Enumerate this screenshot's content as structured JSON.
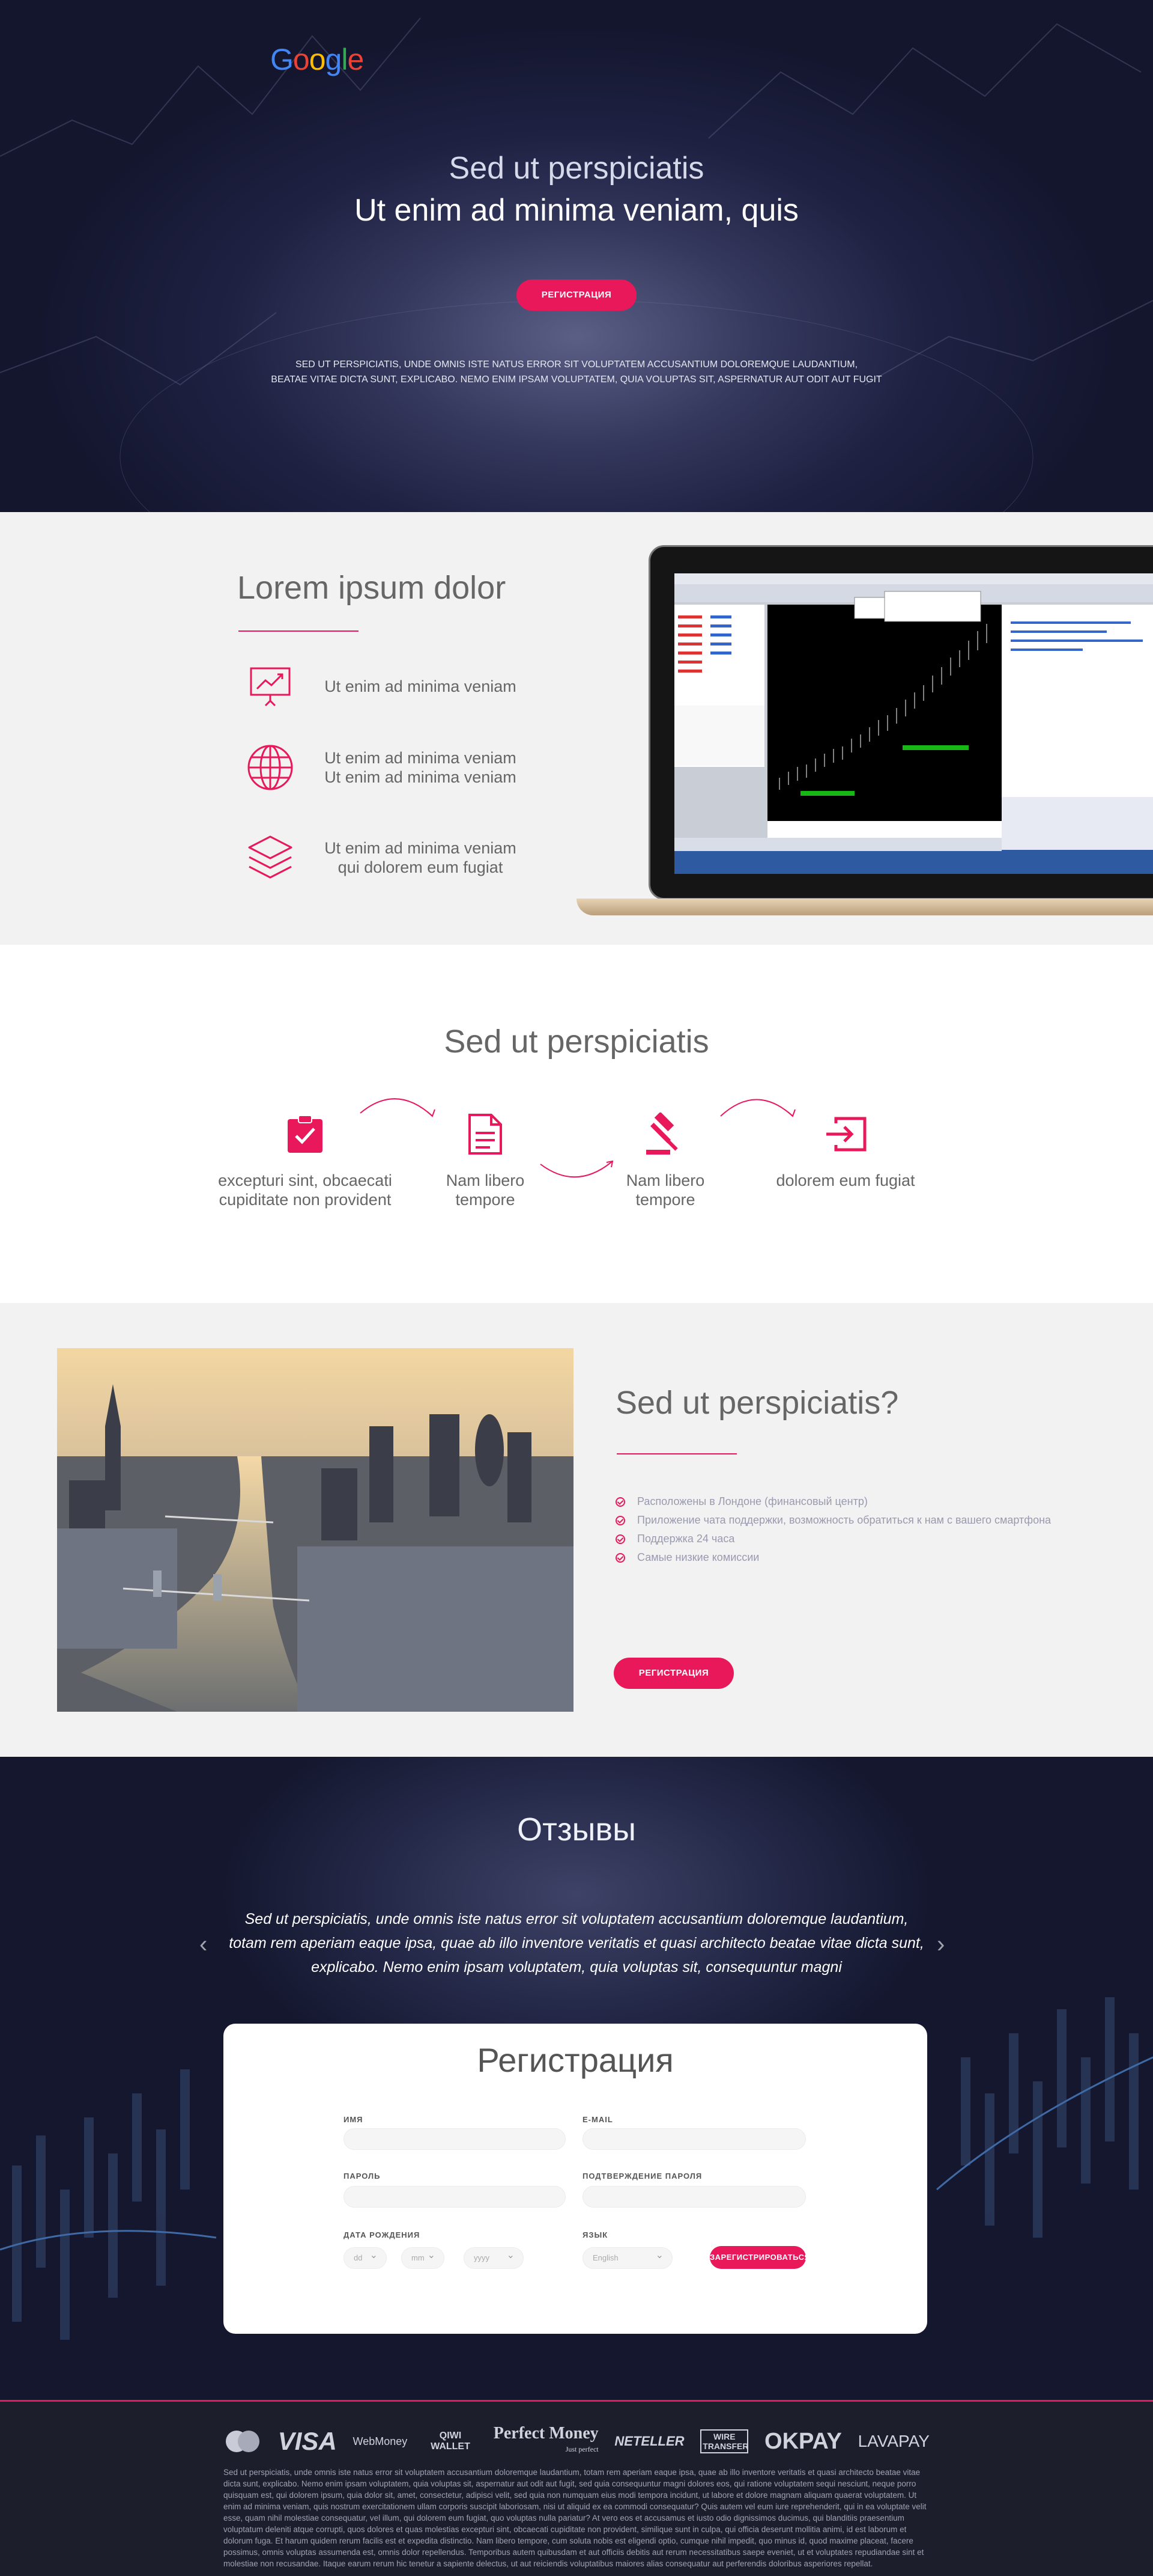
{
  "hero": {
    "logo": "Google",
    "subtitle": "Sed ut perspiciatis",
    "title": "Ut enim ad minima veniam, quis",
    "button": "РЕГИСТРАЦИЯ",
    "description_1": "SED UT PERSPICIATIS, UNDE OMNIS ISTE NATUS ERROR SIT VOLUPTATEM ACCUSANTIUM DOLOREMQUE LAUDANTIUM,",
    "description_2": "BEATAE VITAE DICTA SUNT, EXPLICABO. NEMO ENIM IPSAM VOLUPTATEM, QUIA VOLUPTAS SIT, ASPERNATUR AUT ODIT AUT FUGIT"
  },
  "features": {
    "title": "Lorem ipsum dolor",
    "items": [
      {
        "icon": "presentation-chart-icon",
        "line1": "Ut enim ad minima veniam",
        "line2": ""
      },
      {
        "icon": "globe-icon",
        "line1": "Ut enim ad minima veniam",
        "line2": "Ut enim ad minima veniam"
      },
      {
        "icon": "layers-icon",
        "line1": "Ut enim ad minima veniam",
        "line2": "qui dolorem eum fugiat"
      }
    ]
  },
  "steps": {
    "title": "Sed ut perspiciatis",
    "items": [
      {
        "icon": "clipboard-check-icon",
        "line1": "excepturi sint, obcaecati",
        "line2": "cupiditate non provident"
      },
      {
        "icon": "document-icon",
        "line1": "Nam libero",
        "line2": "tempore"
      },
      {
        "icon": "gavel-icon",
        "line1": "Nam libero",
        "line2": "tempore"
      },
      {
        "icon": "login-icon",
        "line1": "dolorem eum fugiat",
        "line2": ""
      }
    ]
  },
  "about": {
    "title": "Sed ut perspiciatis?",
    "list": [
      "Расположены в Лондоне (финансовый центр)",
      "Приложение чата поддержки, возможность обратиться к нам с вашего смартфона",
      "Поддержка 24 часа",
      "Самые низкие комиссии"
    ],
    "button": "РЕГИСТРАЦИЯ"
  },
  "reviews": {
    "title": "Отзывы",
    "text_1": "Sed ut perspiciatis, unde omnis iste natus error sit voluptatem accusantium doloremque laudantium,",
    "text_2": "totam rem aperiam eaque ipsa, quae ab illo inventore veritatis et quasi architecto beatae vitae dicta sunt,",
    "text_3": "explicabo. Nemo enim ipsam voluptatem, quia voluptas sit, consequuntur magni"
  },
  "registration": {
    "title": "Регистрация",
    "name_label": "ИМЯ",
    "email_label": "E-MAIL",
    "password_label": "ПАРОЛЬ",
    "confirm_label": "ПОДТВЕРЖДЕНИЕ ПАРОЛЯ",
    "dob_label": "ДАТА РОЖДЕНИЯ",
    "lang_label": "ЯЗЫК",
    "dd": "dd",
    "mm": "mm",
    "yyyy": "yyyy",
    "lang_value": "English",
    "submit": "ЗАРЕГИСТРИРОВАТЬСЯ"
  },
  "footer": {
    "payments": [
      "MasterCard",
      "VISA",
      "WebMoney",
      "QIWI WALLET",
      "Perfect Money",
      "NETELLER",
      "WIRE TRANSFER",
      "OKPAY",
      "LAVAPAY"
    ],
    "perfect_money_sub": "Just perfect",
    "text": "Sed ut perspiciatis, unde omnis iste natus error sit voluptatem accusantium doloremque laudantium, totam rem aperiam eaque ipsa, quae ab illo inventore veritatis et quasi architecto beatae vitae dicta sunt, explicabo. Nemo enim ipsam voluptatem, quia voluptas sit, aspernatur aut odit aut fugit, sed quia consequuntur magni dolores eos, qui ratione voluptatem sequi nesciunt, neque porro quisquam est, qui dolorem ipsum, quia dolor sit, amet, consectetur, adipisci velit, sed quia non numquam eius modi tempora incidunt, ut labore et dolore magnam aliquam quaerat voluptatem. Ut enim ad minima veniam, quis nostrum exercitationem ullam corporis suscipit laboriosam, nisi ut aliquid ex ea commodi consequatur? Quis autem vel eum iure reprehenderit, qui in ea voluptate velit esse, quam nihil molestiae consequatur, vel illum, qui dolorem eum fugiat, quo voluptas nulla pariatur? At vero eos et accusamus et iusto odio dignissimos ducimus, qui blanditiis praesentium voluptatum deleniti atque corrupti, quos dolores et quas molestias excepturi sint, obcaecati cupiditate non provident, similique sunt in culpa, qui officia deserunt mollitia animi, id est laborum et dolorum fuga. Et harum quidem rerum facilis est et expedita distinctio. Nam libero tempore, cum soluta nobis est eligendi optio, cumque nihil impedit, quo minus id, quod maxime placeat, facere possimus, omnis voluptas assumenda est, omnis dolor repellendus. Temporibus autem quibusdam et aut officiis debitis aut rerum necessitatibus saepe eveniet, ut et voluptates repudiandae sint et molestiae non recusandae. Itaque earum rerum hic tenetur a sapiente delectus, ut aut reiciendis voluptatibus maiores alias consequatur aut perferendis doloribus asperiores repellat."
  },
  "colors": {
    "accent": "#e8185a",
    "hero_bg": "#1e2142",
    "footer_bg": "#1c1e2c"
  }
}
